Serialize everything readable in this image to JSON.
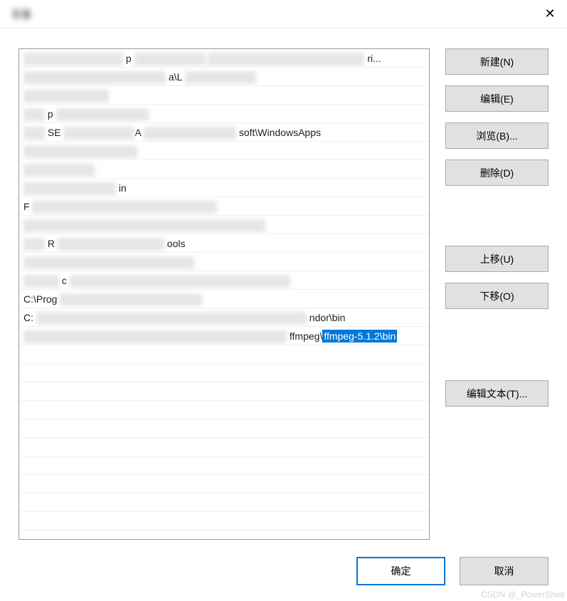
{
  "titlebar": {
    "title": "变量",
    "close_symbol": "✕"
  },
  "list": {
    "items": [
      {
        "text": "p",
        "suffix": "ri..."
      },
      {
        "text": "a\\L"
      },
      {
        "text": ""
      },
      {
        "text": "p"
      },
      {
        "text": "SE",
        "suffix": "soft\\WindowsApps"
      },
      {
        "text": ""
      },
      {
        "text": ""
      },
      {
        "text": "in"
      },
      {
        "text": "F"
      },
      {
        "text": ""
      },
      {
        "text": "R",
        "suffix": "ools"
      },
      {
        "text": ""
      },
      {
        "text": "c"
      },
      {
        "text": "C:\\Prog"
      },
      {
        "text": "C:",
        "suffix": "ndor\\bin"
      },
      {
        "text": "",
        "prefix": "ffmpeg\\",
        "selected_text": "ffmpeg-5.1.2\\bin"
      }
    ]
  },
  "buttons": {
    "new": "新建(N)",
    "edit": "编辑(E)",
    "browse": "浏览(B)...",
    "delete": "删除(D)",
    "move_up": "上移(U)",
    "move_down": "下移(O)",
    "edit_text": "编辑文本(T)...",
    "ok": "确定",
    "cancel": "取消"
  },
  "watermark": "CSDN @_PowerShell"
}
